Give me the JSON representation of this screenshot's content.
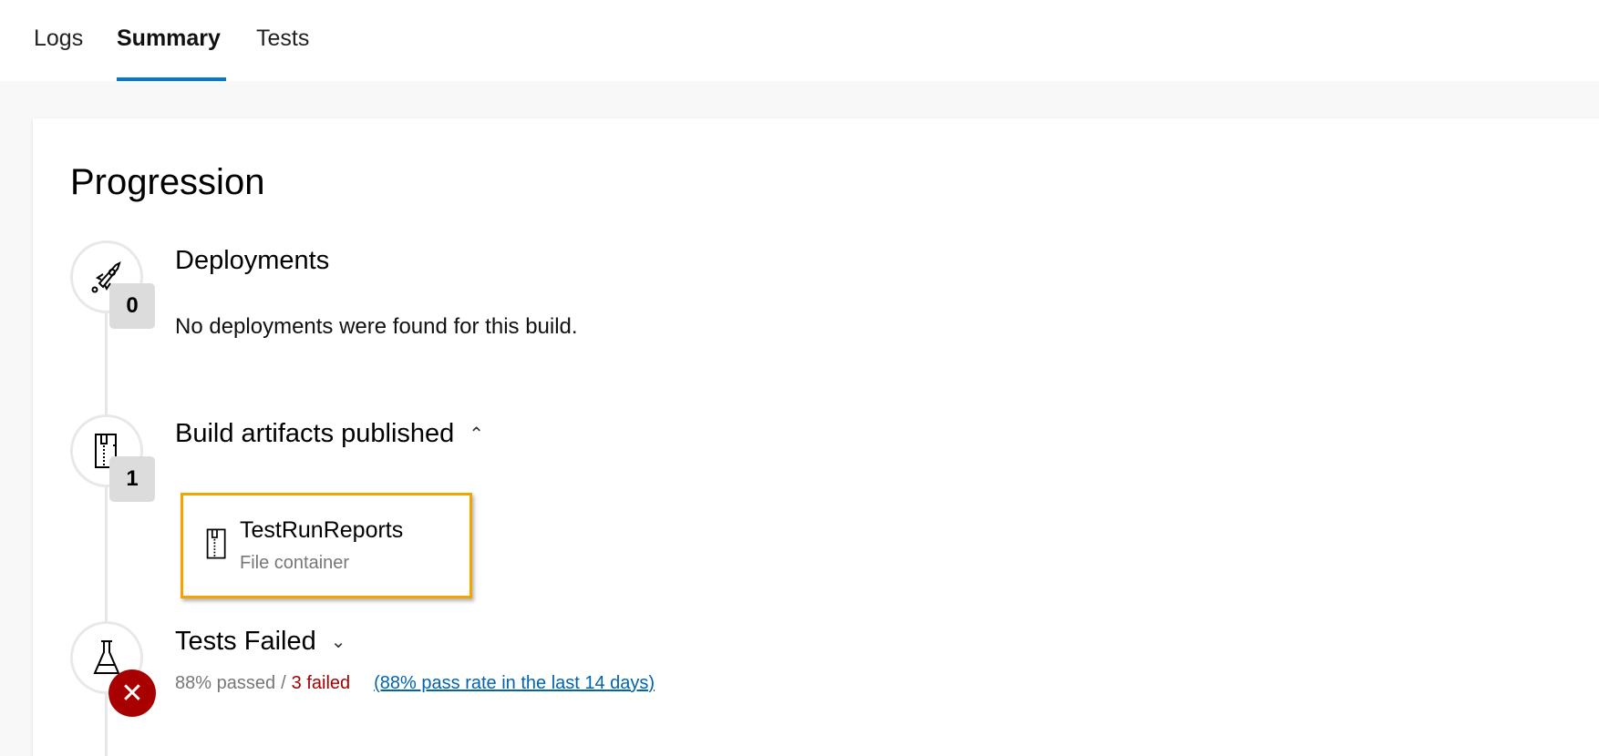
{
  "tabs": [
    {
      "label": "Logs"
    },
    {
      "label": "Summary",
      "active": true
    },
    {
      "label": "Tests"
    }
  ],
  "title": "Progression",
  "deployments": {
    "icon": "rocket-icon",
    "count": "0",
    "heading": "Deployments",
    "message": "No deployments were found for this build."
  },
  "artifacts": {
    "icon": "zip-file-icon",
    "count": "1",
    "heading": "Build artifacts published",
    "expanded": true,
    "items": [
      {
        "name": "TestRunReports",
        "type": "File container"
      }
    ]
  },
  "tests": {
    "icon": "flask-icon",
    "status_icon": "error-icon",
    "heading": "Tests Failed",
    "expanded": false,
    "passed": "88% passed",
    "separator": "/",
    "failed": "3 failed",
    "trend_link": "(88% pass rate in the last 14 days)"
  },
  "colors": {
    "accent": "#0078d4",
    "error": "#a80000",
    "highlight": "#f5a300",
    "link": "#0063b1"
  }
}
